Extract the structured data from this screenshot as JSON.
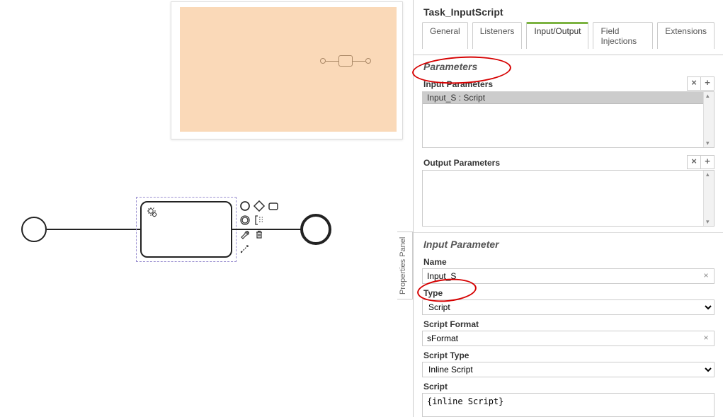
{
  "panel_tab_label": "Properties Panel",
  "header": {
    "title": "Task_InputScript"
  },
  "tabs": [
    {
      "label": "General",
      "active": false
    },
    {
      "label": "Listeners",
      "active": false
    },
    {
      "label": "Input/Output",
      "active": true
    },
    {
      "label": "Field Injections",
      "active": false
    },
    {
      "label": "Extensions",
      "active": false
    }
  ],
  "parameters": {
    "section_title": "Parameters",
    "input_label": "Input Parameters",
    "input_items": [
      {
        "label": "Input_S : Script"
      }
    ],
    "output_label": "Output Parameters",
    "output_items": [],
    "buttons": {
      "remove": "×",
      "add": "+"
    }
  },
  "input_parameter": {
    "section_title": "Input Parameter",
    "name_label": "Name",
    "name_value": "Input_S",
    "type_label": "Type",
    "type_value": "Script",
    "script_format_label": "Script Format",
    "script_format_value": "sFormat",
    "script_type_label": "Script Type",
    "script_type_value": "Inline Script",
    "script_label": "Script",
    "script_value": "{inline Script}"
  },
  "icons": {
    "clear": "×"
  }
}
